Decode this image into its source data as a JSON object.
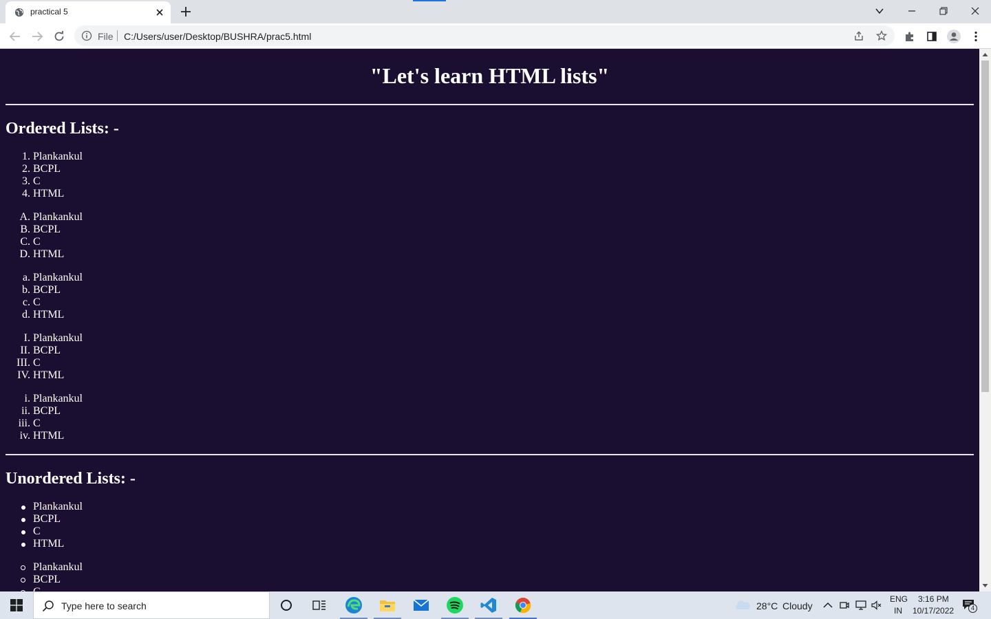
{
  "browser": {
    "tab_title": "practical 5",
    "address_scheme": "File",
    "address_url": "C:/Users/user/Desktop/BUSHRA/prac5.html"
  },
  "page": {
    "title": "\"Let's learn HTML lists\"",
    "ordered_heading": "Ordered Lists: -",
    "unordered_heading": "Unordered Lists: -",
    "ordered_lists": [
      {
        "type": "1",
        "markers": [
          "1.",
          "2.",
          "3.",
          "4."
        ],
        "items": [
          "Plankankul",
          "BCPL",
          "C",
          "HTML"
        ]
      },
      {
        "type": "A",
        "markers": [
          "A.",
          "B.",
          "C.",
          "D."
        ],
        "items": [
          "Plankankul",
          "BCPL",
          "C",
          "HTML"
        ]
      },
      {
        "type": "a",
        "markers": [
          "a.",
          "b.",
          "c.",
          "d."
        ],
        "items": [
          "Plankankul",
          "BCPL",
          "C",
          "HTML"
        ]
      },
      {
        "type": "I",
        "markers": [
          "I.",
          "II.",
          "III.",
          "IV."
        ],
        "items": [
          "Plankankul",
          "BCPL",
          "C",
          "HTML"
        ]
      },
      {
        "type": "i",
        "markers": [
          "i.",
          "ii.",
          "iii.",
          "iv."
        ],
        "items": [
          "Plankankul",
          "BCPL",
          "C",
          "HTML"
        ]
      }
    ],
    "unordered_lists": [
      {
        "style": "disc",
        "items": [
          "Plankankul",
          "BCPL",
          "C",
          "HTML"
        ]
      },
      {
        "style": "circle",
        "items": [
          "Plankankul",
          "BCPL",
          "C"
        ]
      }
    ]
  },
  "taskbar": {
    "search_placeholder": "Type here to search",
    "weather_temp": "28°C",
    "weather_desc": "Cloudy",
    "lang_top": "ENG",
    "lang_bottom": "IN",
    "time": "3:16 PM",
    "date": "10/17/2022",
    "notification_count": "4"
  },
  "colors": {
    "page_bg": "#1a0f30",
    "page_text": "#ffffff",
    "taskbar_bg": "#dde4ee",
    "accent": "#1a73e8"
  }
}
